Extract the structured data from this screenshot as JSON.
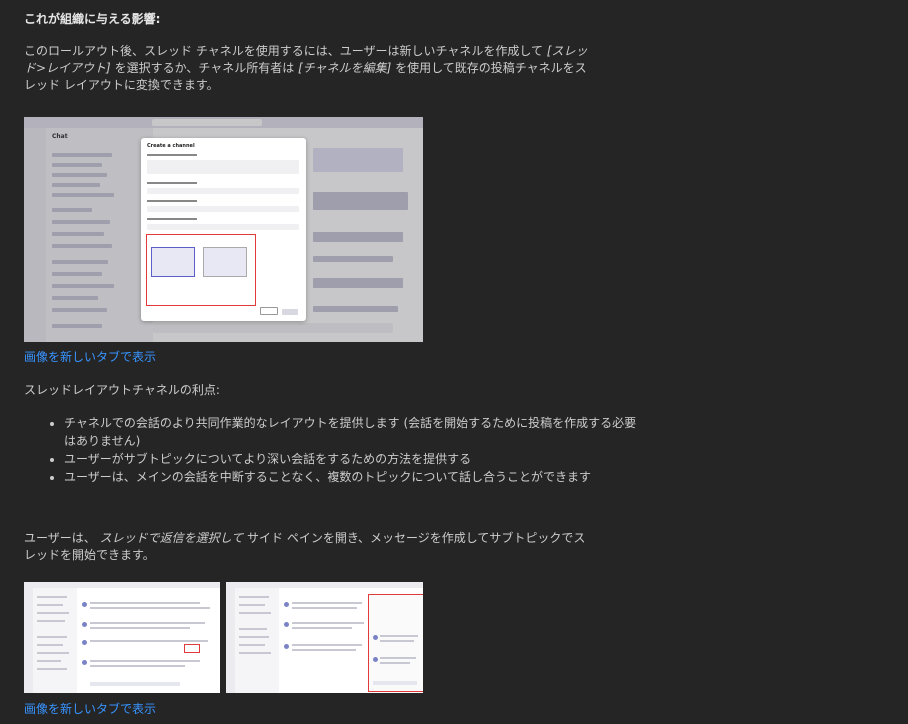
{
  "section": {
    "heading": "これが組織に与える影響:",
    "para1_a": "このロールアウト後、スレッド チャネルを使用するには、ユーザーは新しいチャネルを作成して ",
    "para1_em1": "[スレッド>レイアウト]",
    "para1_b": " を選択するか、チャネル所有者は ",
    "para1_em2": "[チャネルを編集]",
    "para1_c": " を使用して既存の投稿チャネルをスレッド レイアウトに変換できます。",
    "link1": "画像を新しいタブで表示",
    "para2": "スレッドレイアウトチャネルの利点:",
    "bullets": [
      "チャネルでの会話のより共同作業的なレイアウトを提供します (会話を開始するために投稿を作成する必要はありません)",
      "ユーザーがサブトピックについてより深い会話をするための方法を提供する",
      "ユーザーは、メインの会話を中断することなく、複数のトピックについて話し合うことができます"
    ],
    "para3_a": "ユーザーは、 ",
    "para3_em": "スレッドで返信を選択して",
    "para3_b": " サイド ペインを開き、メッセージを作成してサブトピックでスレッドを開始できます。",
    "link2": "画像を新しいタブで表示"
  },
  "screenshot1": {
    "app_title": "Chat",
    "dialog_title": "Create a channel"
  },
  "colors": {
    "background": "#252526",
    "text": "#cccccc",
    "link": "#3794ff",
    "highlight_border": "#e03a3a",
    "teams_accent": "#5b5fc7"
  }
}
